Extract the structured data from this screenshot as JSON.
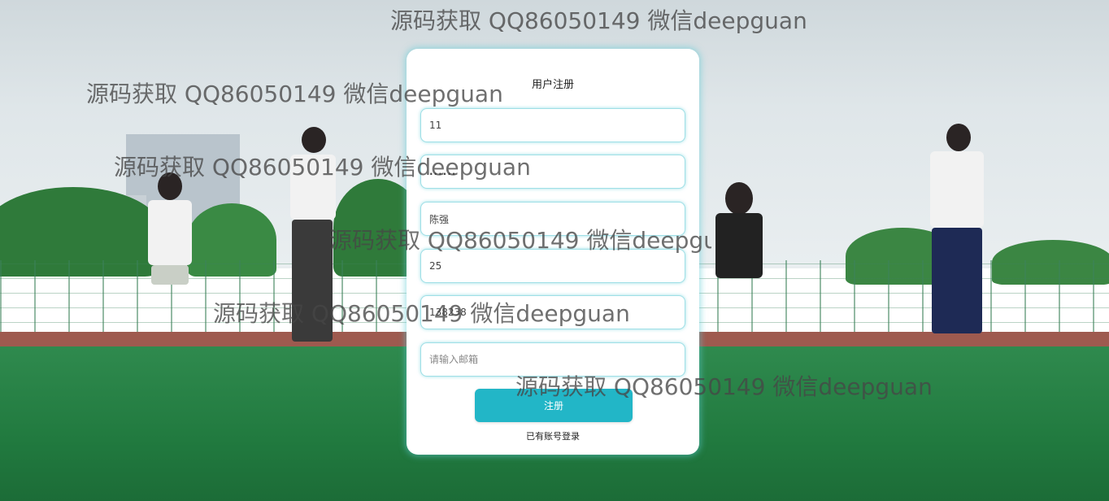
{
  "form": {
    "title": "用户注册",
    "fields": [
      {
        "name": "username",
        "value": "11",
        "placeholder": ""
      },
      {
        "name": "password",
        "value": "......",
        "placeholder": ""
      },
      {
        "name": "realname",
        "value": "陈强",
        "placeholder": ""
      },
      {
        "name": "age",
        "value": "25",
        "placeholder": ""
      },
      {
        "name": "phone",
        "value": "138238",
        "placeholder": ""
      },
      {
        "name": "email",
        "value": "",
        "placeholder": "请输入邮箱"
      }
    ],
    "submit_label": "注册",
    "login_link": "已有账号登录"
  },
  "watermark": "源码获取 QQ86050149 微信deepguan",
  "colors": {
    "accent": "#22b6c7",
    "input_border": "#9edfe6",
    "card_bg": "#ffffff"
  }
}
